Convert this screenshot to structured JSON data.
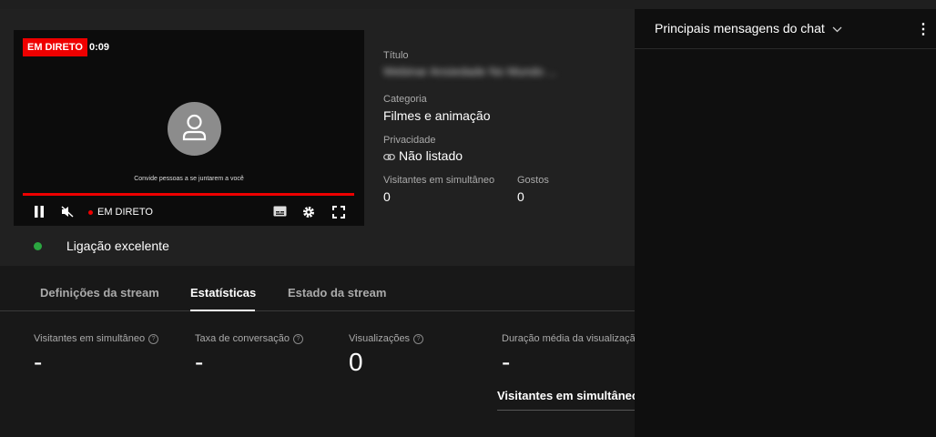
{
  "player": {
    "live_badge": "EM DIRETO",
    "timer": "0:09",
    "invite_text": "Convide pessoas a se juntarem a você",
    "live_control_label": "EM DIRETO"
  },
  "meta": {
    "title_label": "Título",
    "title_value": "Webinar Ansiedade No Mundo ...",
    "category_label": "Categoria",
    "category_value": "Filmes e animação",
    "privacy_label": "Privacidade",
    "privacy_value": "Não listado",
    "viewers_label": "Visitantes em simultâneo",
    "viewers_value": "0",
    "likes_label": "Gostos",
    "likes_value": "0"
  },
  "connection": {
    "label": "Ligação excelente",
    "color": "#2ba640"
  },
  "tabs": [
    {
      "label": "Definições da stream"
    },
    {
      "label": "Estatísticas"
    },
    {
      "label": "Estado da stream"
    }
  ],
  "stats": [
    {
      "label": "Visitantes em simultâneo",
      "value": "-"
    },
    {
      "label": "Taxa de conversação",
      "value": "-"
    },
    {
      "label": "Visualizações",
      "value": "0"
    },
    {
      "label": "Duração média da visualização",
      "value": "-"
    }
  ],
  "stats_subtab": "Visitantes em simultâneo",
  "chat": {
    "title": "Principais mensagens do chat"
  },
  "colors": {
    "accent_red": "#ee0000",
    "background": "#181818"
  }
}
